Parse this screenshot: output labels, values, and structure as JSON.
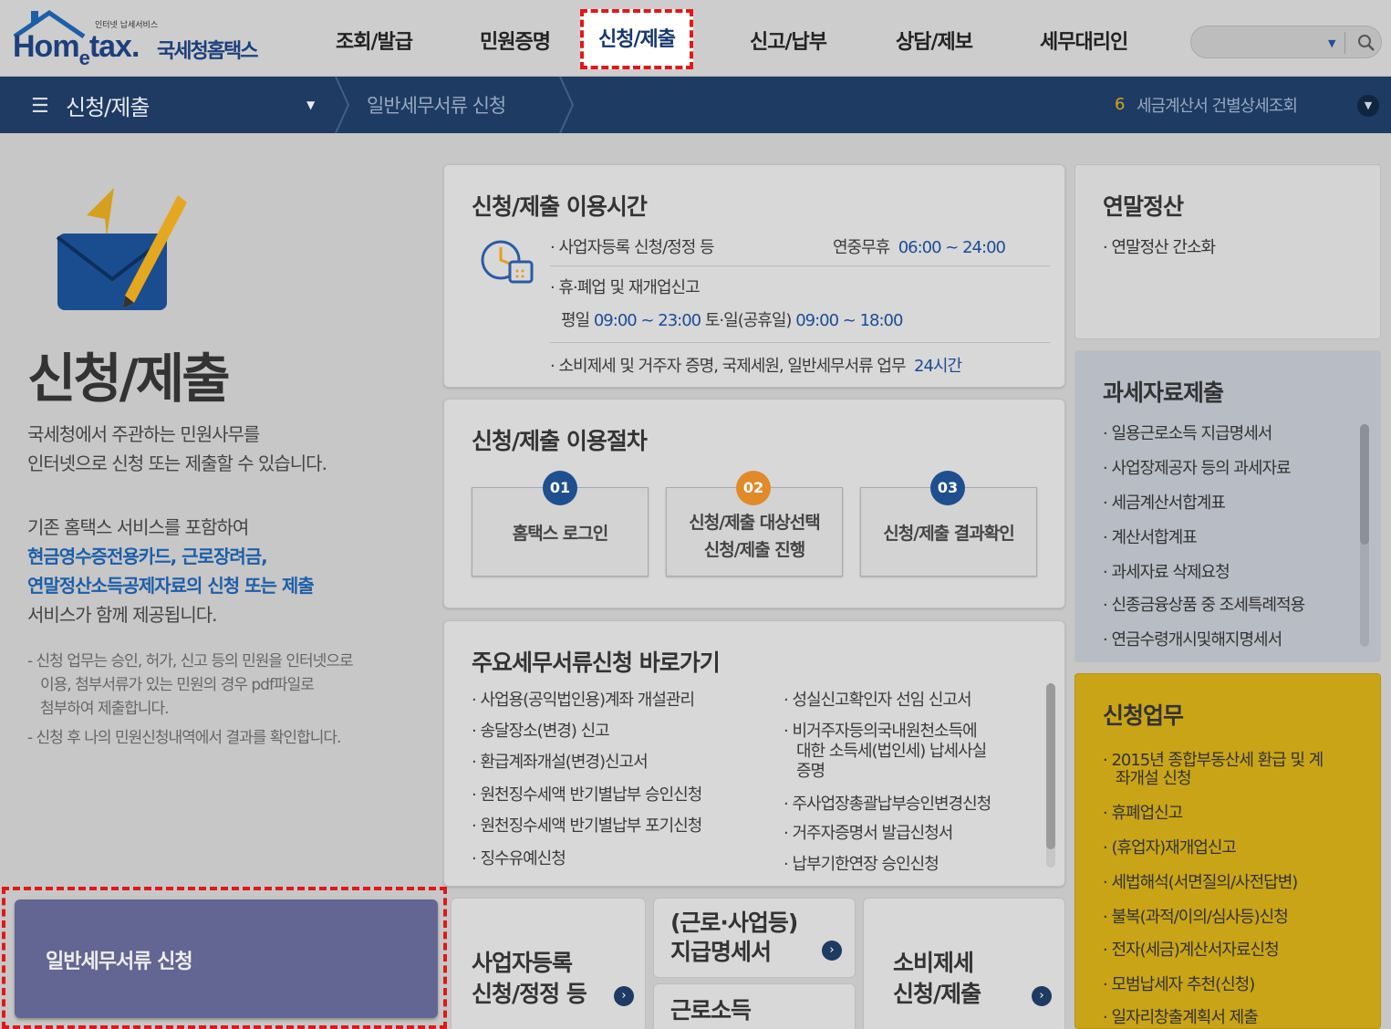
{
  "logo": {
    "tiny": "인터넷 납세서비스",
    "brand_pre": "Hom",
    "brand_e": "e",
    "brand_post": "tax.",
    "korean": "국세청홈택스"
  },
  "nav": [
    "조회/발급",
    "민원증명",
    "신청/제출",
    "신고/납부",
    "상담/제보",
    "세무대리인"
  ],
  "subnav": {
    "current": "신청/제출",
    "crumb": "일반세무서류 신청",
    "rank": "6",
    "trending": "세금계산서 건별상세조회"
  },
  "intro": {
    "title": "신청/제출",
    "p1": [
      "국세청에서 주관하는 민원사무를",
      "인터넷으로 신청 또는 제출할 수 있습니다."
    ],
    "p2_1": "기존 홈택스 서비스를 포함하여",
    "p2_blue": [
      "현금영수증전용카드, 근로장려금,",
      "연말정산소득공제자료의 신청 또는 제출"
    ],
    "p2_end": "서비스가 함께 제공됩니다.",
    "note1": [
      "- 신청 업무는 승인, 허가, 신고 등의 민원을 인터넷으로",
      "이용, 첨부서류가 있는 민원의 경우 pdf파일로",
      "첨부하여 제출합니다."
    ],
    "note2": "- 신청 후 나의 민원신청내역에서 결과를 확인합니다."
  },
  "general_button": "일반세무서류 신청",
  "hours": {
    "title": "신청/제출 이용시간",
    "r1_label": "· 사업자등록 신청/정정 등",
    "r1_pre": "연중무휴",
    "r1_time": "06:00 ~ 24:00",
    "r2_label": "· 휴·폐업 및 재개업신고",
    "r3_pre1": "평일",
    "r3_t1": "09:00 ~ 23:00",
    "r3_pre2": "토·일(공휴일)",
    "r3_t2": "09:00 ~ 18:00",
    "r4_label": "· 소비제세 및 거주자 증명, 국제세원, 일반세무서류 업무",
    "r4_time": "24시간"
  },
  "procedure": {
    "title": "신청/제출 이용절차",
    "steps": [
      {
        "num": "01",
        "lines": [
          "홈택스 로그인"
        ],
        "color": "#1f4f8f"
      },
      {
        "num": "02",
        "lines": [
          "신청/제출 대상선택",
          "신청/제출 진행"
        ],
        "color": "#e08a2a"
      },
      {
        "num": "03",
        "lines": [
          "신청/제출 결과확인"
        ],
        "color": "#1f4f8f"
      }
    ]
  },
  "shortcuts": {
    "title": "주요세무서류신청 바로가기",
    "left": [
      "· 사업용(공익법인용)계좌 개설관리",
      "· 송달장소(변경) 신고",
      "· 환급계좌개설(변경)신고서",
      "· 원천징수세액 반기별납부 승인신청",
      "· 원천징수세액 반기별납부 포기신청",
      "· 징수유예신청"
    ],
    "right": [
      "· 성실신고확인자 선임 신고서",
      "· 비거주자등의국내원천소득에",
      "대한 소득세(법인세) 납세사실",
      "증명",
      "· 주사업장총괄납부승인변경신청",
      "· 거주자증명서 발급신청서",
      "· 납부기한연장 승인신청"
    ]
  },
  "year_end": {
    "title": "연말정산",
    "items": [
      "· 연말정산 간소화"
    ]
  },
  "tax_data": {
    "title": "과세자료제출",
    "items": [
      "· 일용근로소득 지급명세서",
      "· 사업장제공자 등의 과세자료",
      "· 세금계산서합계표",
      "· 계산서합계표",
      "· 과세자료 삭제요청",
      "· 신종금융상품 중 조세특례적용",
      "· 연금수령개시및해지명세서"
    ]
  },
  "apply": {
    "title": "신청업무",
    "items": [
      "· 2015년 종합부동산세 환급 및 계",
      "좌개설 신청",
      "· 휴폐업신고",
      "· (휴업자)재개업신고",
      "· 세법해석(서면질의/사전답변)",
      "· 불복(과적/이의/심사등)신청",
      "· 전자(세금)계산서자료신청",
      "· 모범납세자 추천(신청)",
      "· 일자리창출계획서 제출"
    ]
  },
  "tiles": {
    "biz": [
      "사업자등록",
      "신청/정정 등"
    ],
    "pay": [
      "(근로·사업등)",
      "지급명세서"
    ],
    "labor": "근로소득",
    "excise": [
      "소비제세",
      "신청/제출"
    ]
  },
  "colors": {
    "navy": "#1e3b63",
    "purple_button": "#636592",
    "yellow_card": "#c9a417",
    "highlight": "#e01818"
  }
}
